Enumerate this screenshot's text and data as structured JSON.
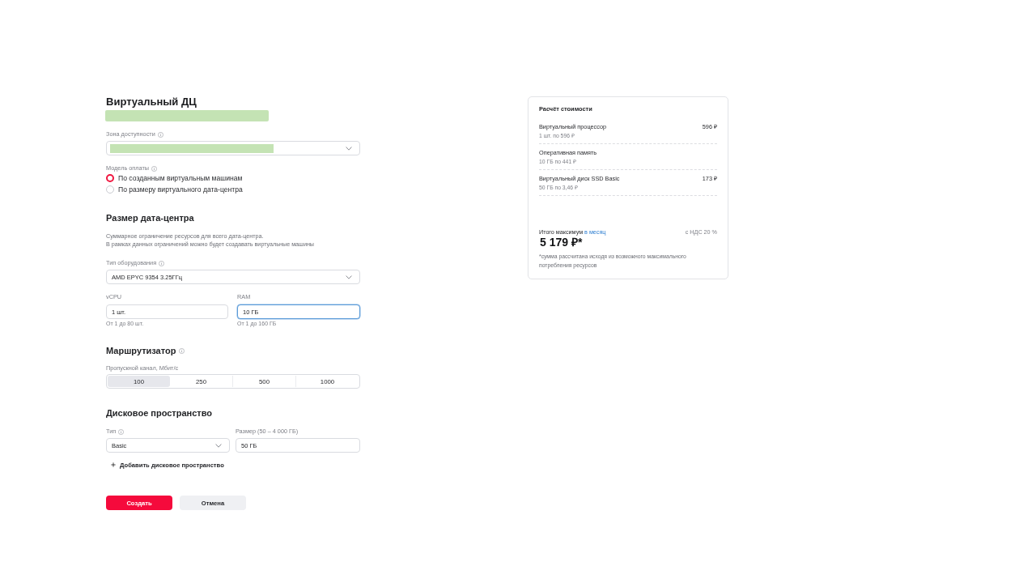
{
  "title": "Виртуальный ДЦ",
  "subtitle": {
    "redacted": true
  },
  "availability_zone": {
    "label": "Зона доступности",
    "info": true,
    "redacted": true
  },
  "payment_model": {
    "label": "Модель оплаты",
    "info": true,
    "options": [
      {
        "label": "По созданным виртуальным машинам",
        "selected": true
      },
      {
        "label": "По размеру виртуального дата-центра",
        "selected": false
      }
    ]
  },
  "dc_size": {
    "heading": "Размер дата-центра",
    "description": [
      "Суммарное ограничение ресурсов для всего дата-центра.",
      "В рамках данных ограничений можно будет создавать виртуальные машины"
    ],
    "hardware": {
      "label": "Тип оборудования",
      "info": true,
      "value": "AMD EPYC 9354 3.25ГГц"
    },
    "fields": [
      {
        "label": "vCPU",
        "value": "1 шт.",
        "hint": "От 1 до 80 шт.",
        "focused": false
      },
      {
        "label": "RAM",
        "value": "10 ГБ",
        "hint": "От 1 до 160 ГБ",
        "focused": true
      }
    ]
  },
  "router": {
    "heading": "Маршрутизатор",
    "info": true,
    "bandwidth": {
      "label": "Пропускной канал, Мбит/с",
      "options": [
        {
          "label": "100",
          "selected": true
        },
        {
          "label": "250",
          "selected": false
        },
        {
          "label": "500",
          "selected": false
        },
        {
          "label": "1000",
          "selected": false
        }
      ]
    }
  },
  "disk": {
    "heading": "Дисковое пространство",
    "type": {
      "label": "Тип",
      "info": true,
      "value": "Basic"
    },
    "size": {
      "label": "Размер (50 – 4 000 ГБ)",
      "value": "50 ГБ"
    },
    "add_link": "Добавить дисковое пространство"
  },
  "buttons": [
    {
      "label": "Создать",
      "kind": "primary"
    },
    {
      "label": "Отмена",
      "kind": "secondary"
    }
  ],
  "cost": {
    "title": "Расчёт стоимости",
    "items": [
      {
        "name": "Виртуальный процессор",
        "detail": "1 шт. по 596 ₽",
        "price": "596 ₽"
      },
      {
        "name": "Оперативная память",
        "detail": "10 ГБ по 441 ₽"
      },
      {
        "name": "Виртуальный диск SSD Basic",
        "detail": "50 ГБ по 3,46 ₽",
        "price": "173 ₽"
      }
    ],
    "total_label": "Итого максимум",
    "total_period": "в месяц",
    "vat": "с НДС 20 %",
    "total": "5 179 ₽*",
    "footnote": "*сумма рассчитана исходя из возможного максимального потребления ресурсов"
  }
}
